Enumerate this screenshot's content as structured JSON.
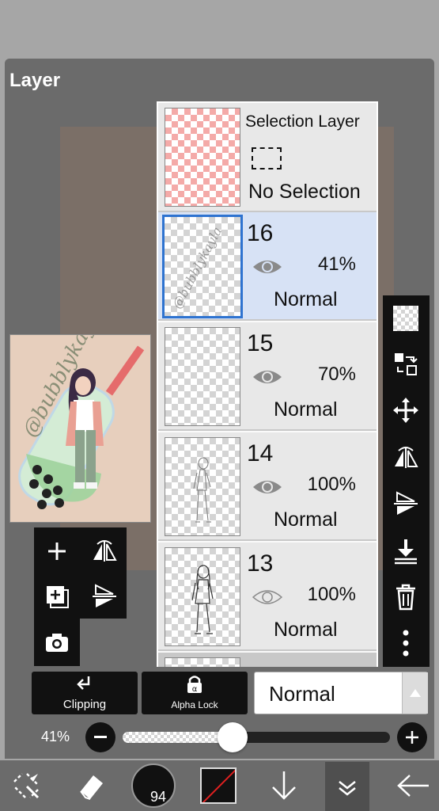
{
  "panel": {
    "title": "Layer"
  },
  "selection_layer": {
    "title": "Selection Layer",
    "status": "No Selection"
  },
  "layers": [
    {
      "number": "16",
      "opacity": "41%",
      "blend": "Normal",
      "visible": true,
      "selected": true,
      "watermark": "@bubblykayla"
    },
    {
      "number": "15",
      "opacity": "70%",
      "blend": "Normal",
      "visible": true,
      "selected": false
    },
    {
      "number": "14",
      "opacity": "100%",
      "blend": "Normal",
      "visible": true,
      "selected": false
    },
    {
      "number": "13",
      "opacity": "100%",
      "blend": "Normal",
      "visible": false,
      "selected": false
    }
  ],
  "preview": {
    "watermark": "@bubblykayla"
  },
  "bottom_buttons": {
    "clipping": "Clipping",
    "alpha_lock": "Alpha Lock",
    "blend_mode": "Normal"
  },
  "opacity_slider": {
    "label": "41%",
    "value": 0.41
  },
  "toolbar": {
    "brush_size": "94"
  },
  "colors": {
    "accent": "#2e73d0",
    "selected_row": "#d7e2f5",
    "panel_bg": "#6b6b6b",
    "canvas_bg": "#e7cfbd"
  }
}
